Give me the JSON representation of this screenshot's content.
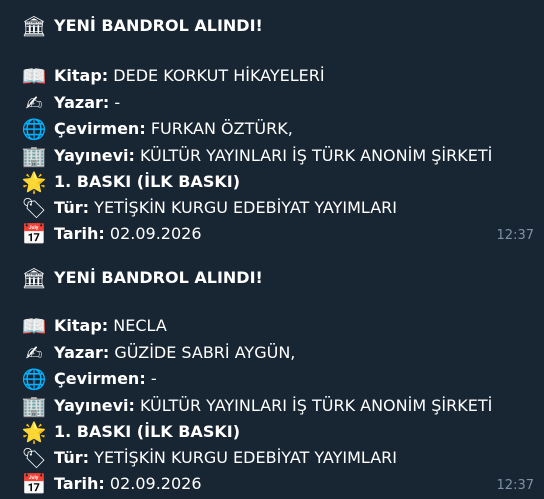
{
  "messages": [
    {
      "title": "YENİ BANDROL ALINDI!",
      "title_icon": "classical-building-icon",
      "book_label": "Kitap:",
      "book_value": "DEDE KORKUT HİKAYELERİ",
      "book_icon": "open-book-icon",
      "author_label": "Yazar:",
      "author_value": "-",
      "author_icon": "writing-hand-icon",
      "translator_label": "Çevirmen:",
      "translator_value": "FURKAN ÖZTÜRK,",
      "translator_icon": "globe-icon",
      "publisher_label": "Yayınevi:",
      "publisher_value": "KÜLTÜR YAYINLARI İŞ TÜRK ANONİM ŞİRKETİ",
      "publisher_icon": "office-building-icon",
      "edition": "1. BASKI (İLK BASKI)",
      "edition_icon": "glowing-star-icon",
      "genre_label": "Tür:",
      "genre_value": "YETİŞKİN KURGU EDEBİYAT YAYIMLARI",
      "genre_icon": "label-tag-icon",
      "date_label": "Tarih:",
      "date_value": "02.09.2026",
      "date_icon": "calendar-icon",
      "time": "12:37"
    },
    {
      "title": "YENİ BANDROL ALINDI!",
      "title_icon": "classical-building-icon",
      "book_label": "Kitap:",
      "book_value": "NECLA",
      "book_icon": "open-book-icon",
      "author_label": "Yazar:",
      "author_value": "GÜZİDE SABRİ AYGÜN,",
      "author_icon": "writing-hand-icon",
      "translator_label": "Çevirmen:",
      "translator_value": "-",
      "translator_icon": "globe-icon",
      "publisher_label": "Yayınevi:",
      "publisher_value": "KÜLTÜR YAYINLARI İŞ TÜRK ANONİM ŞİRKETİ",
      "publisher_icon": "office-building-icon",
      "edition": "1. BASKI (İLK BASKI)",
      "edition_icon": "glowing-star-icon",
      "genre_label": "Tür:",
      "genre_value": "YETİŞKİN KURGU EDEBİYAT YAYIMLARI",
      "genre_icon": "label-tag-icon",
      "date_label": "Tarih:",
      "date_value": "02.09.2026",
      "date_icon": "calendar-icon",
      "time": "12:37"
    }
  ],
  "colors": {
    "background": "#0e1621",
    "bubble": "#182533",
    "text": "#ffffff",
    "timestamp": "#7f91a4"
  }
}
